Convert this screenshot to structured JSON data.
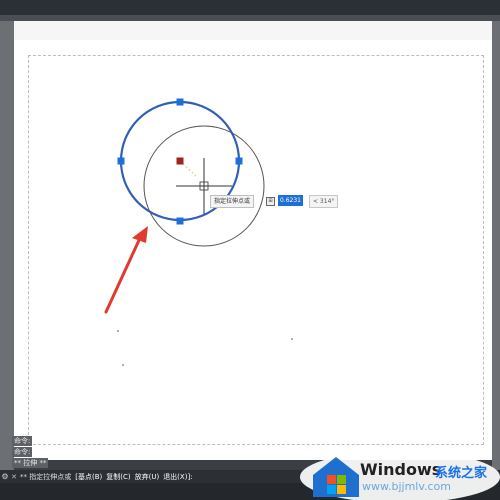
{
  "window": {
    "theme": "dark"
  },
  "drawing": {
    "crosshair_cursor": "crosshair-cursor",
    "grip_color": "#1e6fd9",
    "selected_grip_color": "#a0231c",
    "circle_original_color": "#2f5fb7",
    "circle_preview_color": "#555555",
    "arrow_color": "#e03b2e"
  },
  "dynamic_input": {
    "prompt_label": "指定拉伸点或",
    "value": "0.6231",
    "angle": "< 314°"
  },
  "command_history": {
    "lines": [
      "命令:",
      "命令:",
      "** 拉伸 **"
    ]
  },
  "command_line": {
    "prompt": "** 指定拉伸点或",
    "options": [
      "[基点(B)",
      "复制(C)",
      "放弃(U)",
      "退出(X)]:"
    ]
  },
  "watermark": {
    "brand": "Windows",
    "cn": "系统之家",
    "url": "www.bjjmlv.com"
  }
}
